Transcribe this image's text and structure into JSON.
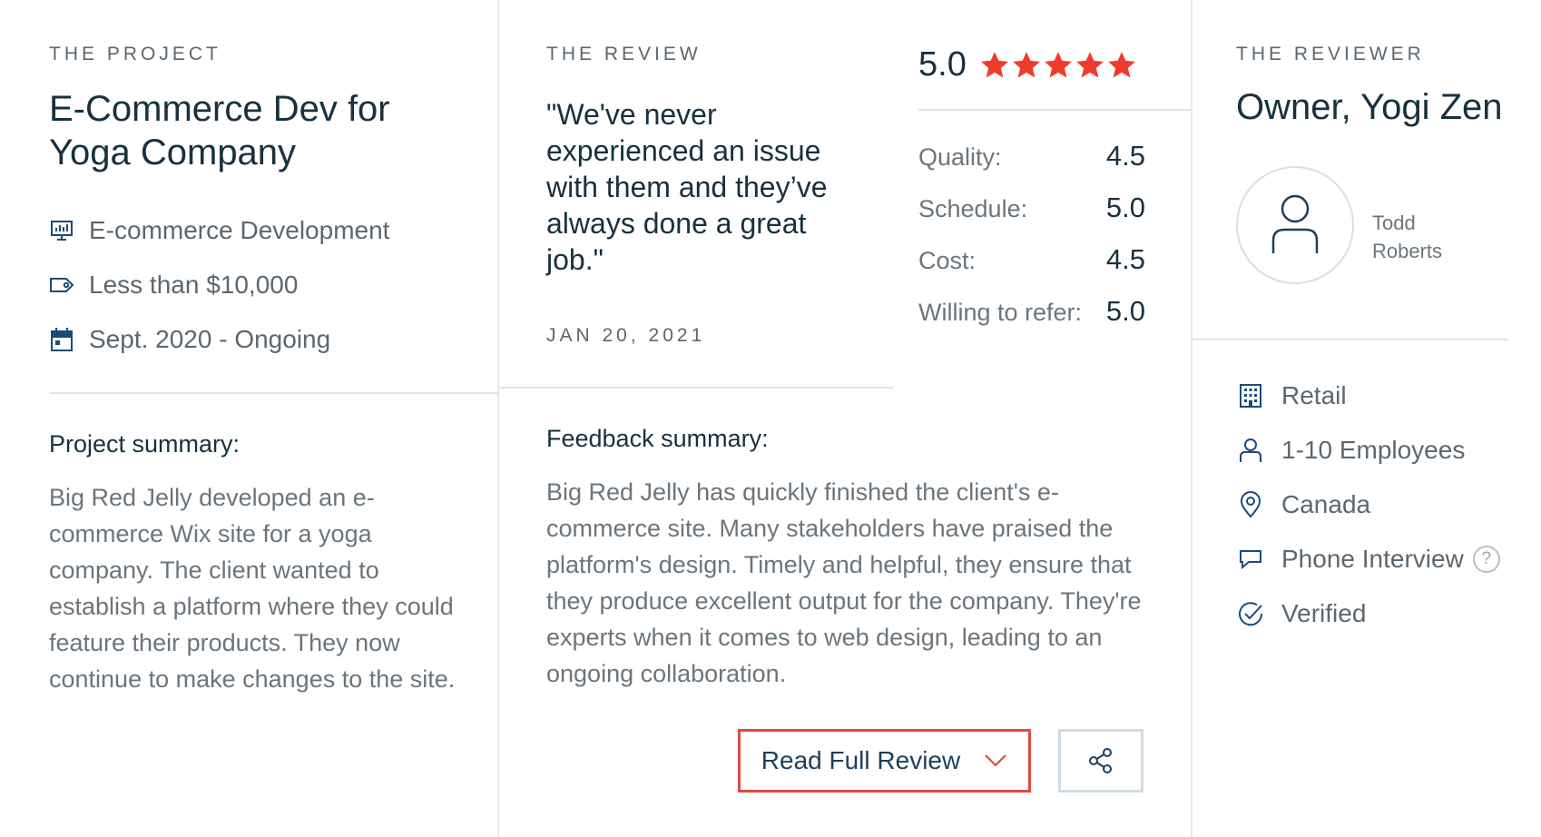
{
  "project": {
    "eyebrow": "THE PROJECT",
    "title": "E-Commerce Dev for Yoga Company",
    "service": "E-commerce Development",
    "budget": "Less than $10,000",
    "dates": "Sept. 2020 - Ongoing",
    "summary_title": "Project summary:",
    "summary": "Big Red Jelly developed an e-commerce Wix site for a yoga company. The client wanted to establish a platform where they could feature their products. They now continue to make changes to the site."
  },
  "review": {
    "eyebrow": "THE REVIEW",
    "quote": "\"We've never experienced an issue with them and they’ve always done a great job.\"",
    "date": "JAN 20, 2021",
    "overall": "5.0",
    "stars": 5,
    "star_color": "#ef3b2c",
    "ratings": [
      {
        "label": "Quality:",
        "value": "4.5"
      },
      {
        "label": "Schedule:",
        "value": "5.0"
      },
      {
        "label": "Cost:",
        "value": "4.5"
      },
      {
        "label": "Willing to refer:",
        "value": "5.0"
      }
    ],
    "feedback_title": "Feedback summary:",
    "feedback": "Big Red Jelly has quickly finished the client's e-commerce site. Many stakeholders have praised the platform's design. Timely and helpful, they ensure that they produce excellent output for the company. They're experts when it comes to web design, leading to an ongoing collaboration.",
    "read_full_label": "Read Full Review"
  },
  "reviewer": {
    "eyebrow": "THE REVIEWER",
    "title": "Owner, Yogi Zen",
    "first_name": "Todd",
    "last_name": "Roberts",
    "industry": "Retail",
    "size": "1-10 Employees",
    "location": "Canada",
    "method": "Phone Interview",
    "help": "?",
    "status": "Verified"
  },
  "colors": {
    "accent_red": "#e04a3f",
    "icon_blue": "#1c4b7a",
    "text_dark": "#17313f",
    "text_muted": "#6b757d"
  }
}
